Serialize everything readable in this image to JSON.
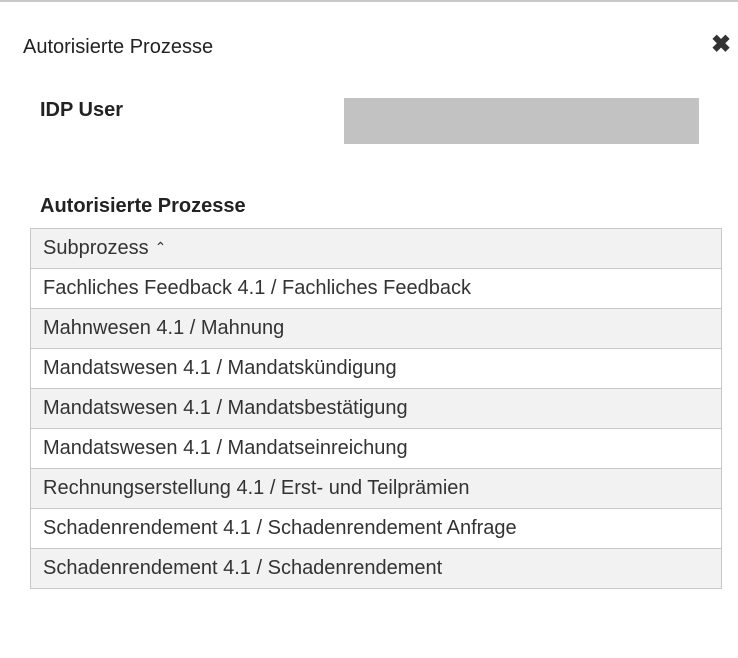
{
  "dialog": {
    "title": "Autorisierte Prozesse",
    "close_icon": "close-icon"
  },
  "user_field": {
    "label": "IDP User",
    "value": ""
  },
  "section": {
    "title": "Autorisierte Prozesse"
  },
  "table": {
    "column_header": "Subprozess",
    "sort_icon": "chevron-up-icon",
    "rows": [
      "Fachliches Feedback 4.1 / Fachliches Feedback",
      "Mahnwesen 4.1 / Mahnung",
      "Mandatswesen 4.1 / Mandatskündigung",
      "Mandatswesen 4.1 / Mandatsbestätigung",
      "Mandatswesen 4.1 / Mandatseinreichung",
      "Rechnungserstellung 4.1 / Erst- und Teilprämien",
      "Schadenrendement 4.1 / Schadenrendement Anfrage",
      "Schadenrendement 4.1 / Schadenrendement"
    ]
  }
}
